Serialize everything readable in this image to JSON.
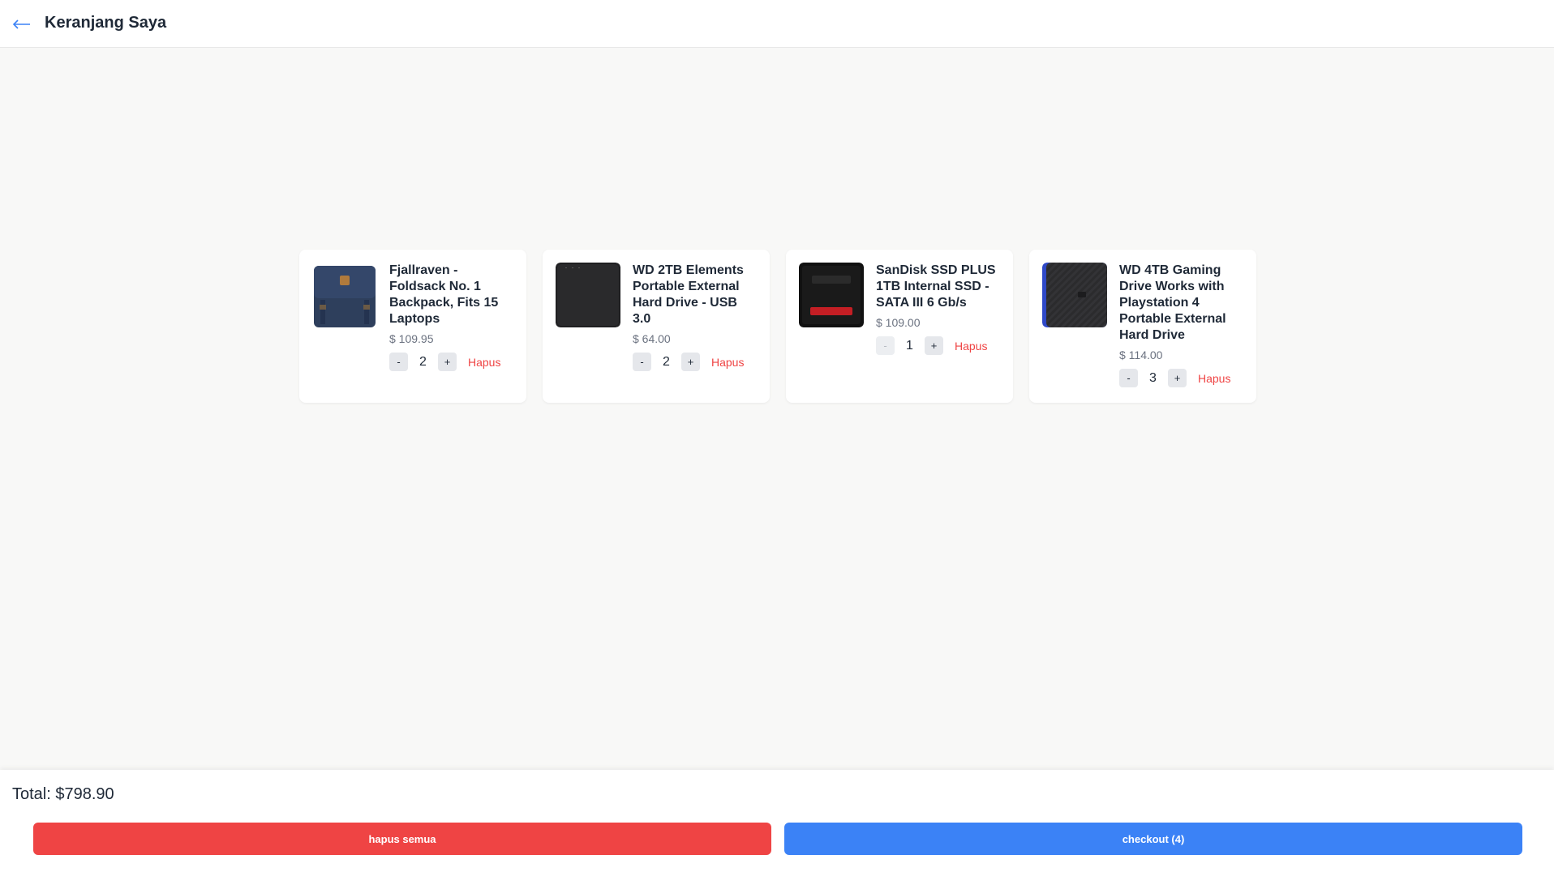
{
  "header": {
    "title": "Keranjang Saya",
    "back_icon": "arrow-left-icon",
    "accent_color": "#3b82f6"
  },
  "cart": {
    "items": [
      {
        "title": "Fjallraven - Foldsack No. 1 Backpack, Fits 15 Laptops",
        "price": "$ 109.95",
        "quantity": "2",
        "decrement_label": "-",
        "increment_label": "+",
        "remove_label": "Hapus"
      },
      {
        "title": "WD 2TB Elements Portable External Hard Drive - USB 3.0",
        "price": "$ 64.00",
        "quantity": "2",
        "decrement_label": "-",
        "increment_label": "+",
        "remove_label": "Hapus"
      },
      {
        "title": "SanDisk SSD PLUS 1TB Internal SSD - SATA III 6 Gb/s",
        "price": "$ 109.00",
        "quantity": "1",
        "decrement_label": "-",
        "increment_label": "+",
        "remove_label": "Hapus"
      },
      {
        "title": "WD 4TB Gaming Drive Works with Playstation 4 Portable External Hard Drive",
        "price": "$ 114.00",
        "quantity": "3",
        "decrement_label": "-",
        "increment_label": "+",
        "remove_label": "Hapus"
      }
    ]
  },
  "footer": {
    "total": "Total: $798.90",
    "clear_label": "hapus semua",
    "checkout_label": "checkout (4)",
    "clear_color": "#ef4444",
    "checkout_color": "#3b82f6"
  }
}
